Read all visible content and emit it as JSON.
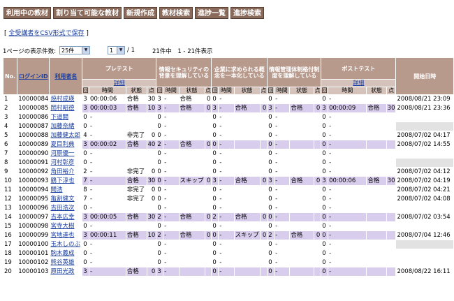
{
  "tabs": [
    "利用中の教材",
    "割り当て可能な教材",
    "新規作成",
    "教材検索",
    "進捗一覧",
    "進捗検索"
  ],
  "csv_link": "全受講者をCSV形式で保存",
  "csv_open": "[",
  "csv_close": "]",
  "pager": {
    "per_page_label": "1ページの表示件数:",
    "per_page_value": "25件",
    "page_value": "1",
    "page_total": "/ 1",
    "summary": "21件中　1 - 21件表示"
  },
  "headers": {
    "no": "No.",
    "login_id": "ログインID",
    "user_name": "利用者名",
    "pretest": "プレテスト",
    "pretest_detail": "詳細",
    "security": "情報セキュリティの背景を理解している",
    "society": "企業に求められる概念を一本化している",
    "infomgmt": "情報管理体制格付制度を理解している",
    "posttest": "ポストテスト",
    "posttest_detail": "詳細",
    "start_time": "開始日時",
    "sub_count": "回",
    "sub_time": "時間",
    "sub_state": "状態",
    "sub_point": "点"
  },
  "rows": [
    {
      "no": "1",
      "id": "10000084",
      "name": "焼村成瑛",
      "hl": false,
      "pc": "3",
      "pt": "00:00:06",
      "ps": "合格",
      "pp": "30",
      "s1c": "3",
      "s1t": "-",
      "s1s": "合格",
      "s1p": "0",
      "s2c": "0",
      "s2t": "-",
      "s2s": "",
      "s2p": "",
      "s3c": "0",
      "s3t": "-",
      "s3s": "",
      "s3p": "",
      "qc": "0",
      "qt": "-",
      "qs": "",
      "qp": "",
      "start": "2008/08/21 23:09",
      "gray": false
    },
    {
      "no": "2",
      "id": "10000085",
      "name": "岡村昭德",
      "hl": true,
      "pc": "3",
      "pt": "00:00:03",
      "ps": "合格",
      "pp": "10",
      "s1c": "3",
      "s1t": "-",
      "s1s": "合格",
      "s1p": "0",
      "s2c": "3",
      "s2t": "-",
      "s2s": "合格",
      "s2p": "0",
      "s3c": "3",
      "s3t": "-",
      "s3s": "合格",
      "s3p": "0",
      "qc": "3",
      "qt": "00:00:09",
      "qs": "合格",
      "qp": "30",
      "start": "2008/08/21 23:36",
      "gray": false
    },
    {
      "no": "3",
      "id": "10000086",
      "name": "下道閲",
      "hl": false,
      "pc": "0",
      "pt": "-",
      "ps": "",
      "pp": "",
      "s1c": "0",
      "s1t": "-",
      "s1s": "",
      "s1p": "",
      "s2c": "0",
      "s2t": "-",
      "s2s": "",
      "s2p": "",
      "s3c": "0",
      "s3t": "-",
      "s3s": "",
      "s3p": "",
      "qc": "0",
      "qt": "-",
      "qs": "",
      "qp": "",
      "start": "",
      "gray": false
    },
    {
      "no": "4",
      "id": "10000087",
      "name": "加藤奈緒",
      "hl": false,
      "pc": "0",
      "pt": "-",
      "ps": "",
      "pp": "",
      "s1c": "0",
      "s1t": "-",
      "s1s": "",
      "s1p": "",
      "s2c": "0",
      "s2t": "-",
      "s2s": "",
      "s2p": "",
      "s3c": "0",
      "s3t": "-",
      "s3s": "",
      "s3p": "",
      "qc": "0",
      "qt": "-",
      "qs": "",
      "qp": "",
      "start": "",
      "gray": true
    },
    {
      "no": "5",
      "id": "10000088",
      "name": "加藤健太郎",
      "hl": false,
      "pc": "4",
      "pt": "-",
      "ps": "非完了",
      "pp": "0",
      "s1c": "0",
      "s1t": "-",
      "s1s": "",
      "s1p": "",
      "s2c": "0",
      "s2t": "-",
      "s2s": "",
      "s2p": "",
      "s3c": "0",
      "s3t": "-",
      "s3s": "",
      "s3p": "",
      "qc": "0",
      "qt": "-",
      "qs": "",
      "qp": "",
      "start": "2008/07/02 04:17",
      "gray": false
    },
    {
      "no": "6",
      "id": "10000089",
      "name": "夏目利典",
      "hl": true,
      "pc": "3",
      "pt": "00:00:02",
      "ps": "合格",
      "pp": "40",
      "s1c": "2",
      "s1t": "-",
      "s1s": "合格",
      "s1p": "0",
      "s2c": "0",
      "s2t": "-",
      "s2s": "",
      "s2p": "",
      "s3c": "0",
      "s3t": "-",
      "s3s": "",
      "s3p": "",
      "qc": "0",
      "qt": "-",
      "qs": "",
      "qp": "",
      "start": "2008/07/02 14:55",
      "gray": false
    },
    {
      "no": "7",
      "id": "10000090",
      "name": "河原優一",
      "hl": false,
      "pc": "0",
      "pt": "-",
      "ps": "",
      "pp": "",
      "s1c": "0",
      "s1t": "-",
      "s1s": "",
      "s1p": "",
      "s2c": "0",
      "s2t": "-",
      "s2s": "",
      "s2p": "",
      "s3c": "0",
      "s3t": "-",
      "s3s": "",
      "s3p": "",
      "qc": "0",
      "qt": "-",
      "qs": "",
      "qp": "",
      "start": "",
      "gray": false
    },
    {
      "no": "8",
      "id": "10000091",
      "name": "河村彰彦",
      "hl": false,
      "pc": "0",
      "pt": "-",
      "ps": "",
      "pp": "",
      "s1c": "0",
      "s1t": "-",
      "s1s": "",
      "s1p": "",
      "s2c": "0",
      "s2t": "-",
      "s2s": "",
      "s2p": "",
      "s3c": "0",
      "s3t": "-",
      "s3s": "",
      "s3p": "",
      "qc": "0",
      "qt": "-",
      "qs": "",
      "qp": "",
      "start": "",
      "gray": true
    },
    {
      "no": "9",
      "id": "10000092",
      "name": "角田裕介",
      "hl": false,
      "pc": "2",
      "pt": "-",
      "ps": "非完了",
      "pp": "0",
      "s1c": "0",
      "s1t": "-",
      "s1s": "",
      "s1p": "",
      "s2c": "0",
      "s2t": "-",
      "s2s": "",
      "s2p": "",
      "s3c": "0",
      "s3t": "-",
      "s3s": "",
      "s3p": "",
      "qc": "0",
      "qt": "-",
      "qs": "",
      "qp": "",
      "start": "2008/07/02 04:12",
      "gray": false
    },
    {
      "no": "10",
      "id": "10000093",
      "name": "鶴下淳也",
      "hl": true,
      "pc": "7",
      "pt": "-",
      "ps": "合格",
      "pp": "30",
      "s1c": "0",
      "s1t": "-",
      "s1s": "スキップ",
      "s1p": "0",
      "s2c": "3",
      "s2t": "-",
      "s2s": "合格",
      "s2p": "0",
      "s3c": "3",
      "s3t": "-",
      "s3s": "合格",
      "s3p": "0",
      "qc": "3",
      "qt": "00:00:06",
      "qs": "合格",
      "qp": "30",
      "start": "2008/07/02 04:19",
      "gray": false
    },
    {
      "no": "11",
      "id": "10000094",
      "name": "聞浩",
      "hl": false,
      "pc": "8",
      "pt": "-",
      "ps": "非完了",
      "pp": "0",
      "s1c": "0",
      "s1t": "-",
      "s1s": "",
      "s1p": "",
      "s2c": "0",
      "s2t": "-",
      "s2s": "",
      "s2p": "",
      "s3c": "0",
      "s3t": "-",
      "s3s": "",
      "s3p": "",
      "qc": "0",
      "qt": "-",
      "qs": "",
      "qp": "",
      "start": "2008/07/02 04:21",
      "gray": false
    },
    {
      "no": "12",
      "id": "10000095",
      "name": "亀割健文",
      "hl": false,
      "pc": "7",
      "pt": "-",
      "ps": "非完了",
      "pp": "0",
      "s1c": "0",
      "s1t": "-",
      "s1s": "",
      "s1p": "",
      "s2c": "0",
      "s2t": "-",
      "s2s": "",
      "s2p": "",
      "s3c": "0",
      "s3t": "-",
      "s3s": "",
      "s3p": "",
      "qc": "0",
      "qt": "-",
      "qs": "",
      "qp": "",
      "start": "2008/07/02 04:08",
      "gray": false
    },
    {
      "no": "13",
      "id": "10000096",
      "name": "吉田浩次",
      "hl": false,
      "pc": "0",
      "pt": "-",
      "ps": "",
      "pp": "",
      "s1c": "0",
      "s1t": "-",
      "s1s": "",
      "s1p": "",
      "s2c": "0",
      "s2t": "-",
      "s2s": "",
      "s2p": "",
      "s3c": "0",
      "s3t": "-",
      "s3s": "",
      "s3p": "",
      "qc": "0",
      "qt": "-",
      "qs": "",
      "qp": "",
      "start": "",
      "gray": false
    },
    {
      "no": "14",
      "id": "10000097",
      "name": "吉本広幸",
      "hl": true,
      "pc": "3",
      "pt": "00:00:05",
      "ps": "合格",
      "pp": "30",
      "s1c": "2",
      "s1t": "-",
      "s1s": "合格",
      "s1p": "0",
      "s2c": "2",
      "s2t": "-",
      "s2s": "合格",
      "s2p": "0",
      "s3c": "0",
      "s3t": "-",
      "s3s": "",
      "s3p": "",
      "qc": "0",
      "qt": "-",
      "qs": "",
      "qp": "",
      "start": "2008/07/02 03:54",
      "gray": false
    },
    {
      "no": "15",
      "id": "10000098",
      "name": "宮寺大樹",
      "hl": false,
      "pc": "0",
      "pt": "-",
      "ps": "",
      "pp": "",
      "s1c": "0",
      "s1t": "-",
      "s1s": "",
      "s1p": "",
      "s2c": "0",
      "s2t": "-",
      "s2s": "",
      "s2p": "",
      "s3c": "0",
      "s3t": "-",
      "s3s": "",
      "s3p": "",
      "qc": "0",
      "qt": "-",
      "qs": "",
      "qp": "",
      "start": "",
      "gray": false
    },
    {
      "no": "16",
      "id": "10000099",
      "name": "宮地達也",
      "hl": true,
      "pc": "3",
      "pt": "00:00:11",
      "ps": "合格",
      "pp": "10",
      "s1c": "2",
      "s1t": "-",
      "s1s": "合格",
      "s1p": "0",
      "s2c": "0",
      "s2t": "-",
      "s2s": "スキップ",
      "s2p": "0",
      "s3c": "2",
      "s3t": "-",
      "s3s": "合格",
      "s3p": "0",
      "qc": "0",
      "qt": "-",
      "qs": "",
      "qp": "",
      "start": "2008/07/04 12:46",
      "gray": false
    },
    {
      "no": "17",
      "id": "10000100",
      "name": "玉木しのぶ",
      "hl": false,
      "pc": "0",
      "pt": "-",
      "ps": "",
      "pp": "",
      "s1c": "0",
      "s1t": "-",
      "s1s": "",
      "s1p": "",
      "s2c": "0",
      "s2t": "-",
      "s2s": "",
      "s2p": "",
      "s3c": "0",
      "s3t": "-",
      "s3s": "",
      "s3p": "",
      "qc": "0",
      "qt": "-",
      "qs": "",
      "qp": "",
      "start": "",
      "gray": true
    },
    {
      "no": "18",
      "id": "10000101",
      "name": "駒木義成",
      "hl": false,
      "pc": "0",
      "pt": "-",
      "ps": "",
      "pp": "",
      "s1c": "0",
      "s1t": "-",
      "s1s": "",
      "s1p": "",
      "s2c": "0",
      "s2t": "-",
      "s2s": "",
      "s2p": "",
      "s3c": "0",
      "s3t": "-",
      "s3s": "",
      "s3p": "",
      "qc": "0",
      "qt": "-",
      "qs": "",
      "qp": "",
      "start": "",
      "gray": false
    },
    {
      "no": "19",
      "id": "10000102",
      "name": "熊谷英雄",
      "hl": false,
      "pc": "0",
      "pt": "-",
      "ps": "",
      "pp": "",
      "s1c": "0",
      "s1t": "-",
      "s1s": "",
      "s1p": "",
      "s2c": "0",
      "s2t": "-",
      "s2s": "",
      "s2p": "",
      "s3c": "0",
      "s3t": "-",
      "s3s": "",
      "s3p": "",
      "qc": "0",
      "qt": "-",
      "qs": "",
      "qp": "",
      "start": "",
      "gray": false
    },
    {
      "no": "20",
      "id": "10000103",
      "name": "原田光政",
      "hl": true,
      "pc": "3",
      "pt": "-",
      "ps": "合格",
      "pp": "0",
      "s1c": "3",
      "s1t": "-",
      "s1s": "",
      "s1p": "",
      "s2c": "0",
      "s2t": "-",
      "s2s": "",
      "s2p": "",
      "s3c": "0",
      "s3t": "-",
      "s3s": "",
      "s3p": "",
      "qc": "0",
      "qt": "-",
      "qs": "",
      "qp": "",
      "start": "2008/08/22 16:11",
      "gray": false
    }
  ]
}
